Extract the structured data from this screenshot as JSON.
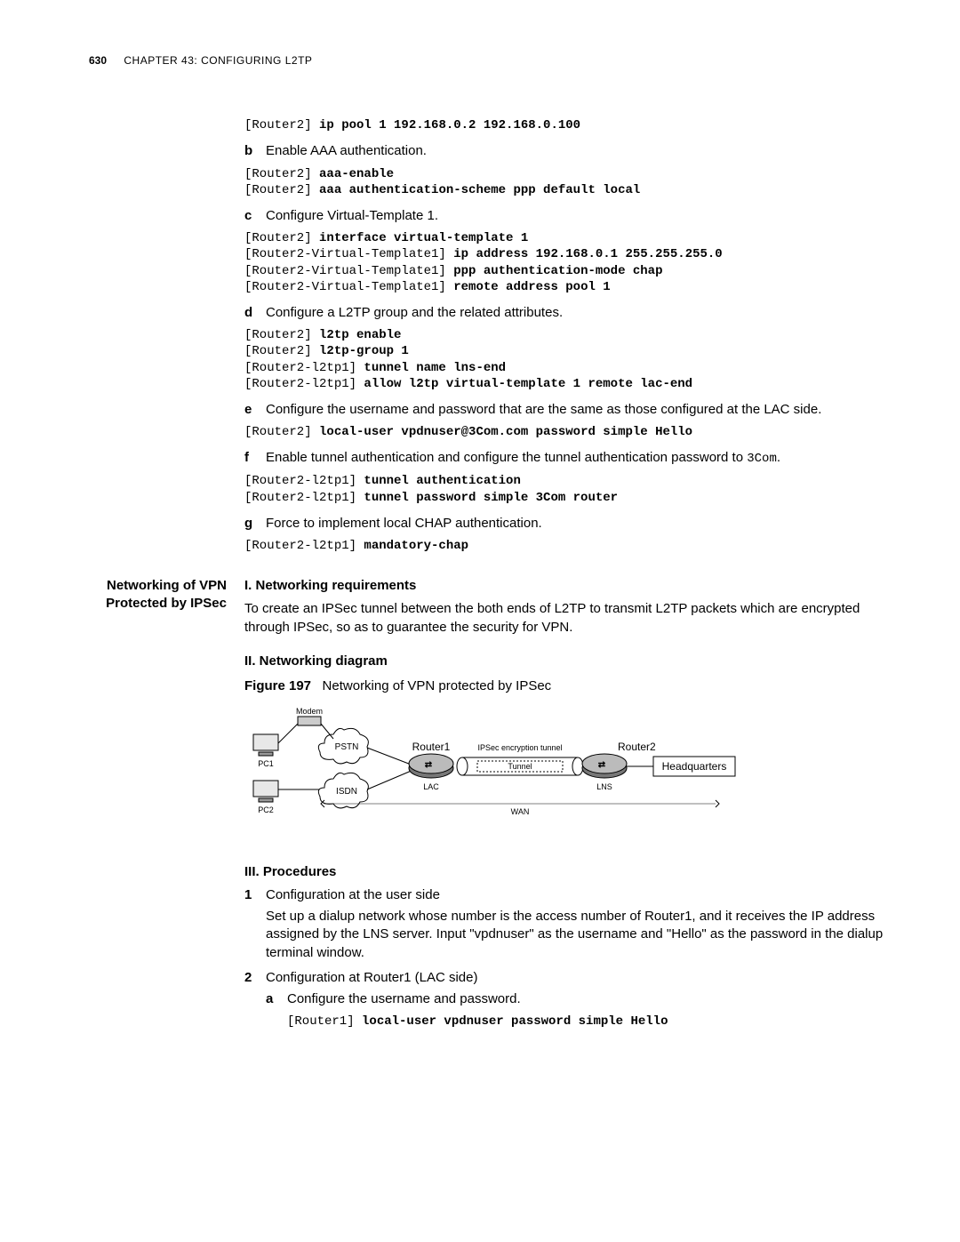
{
  "header": {
    "page": "630",
    "chapter": "CHAPTER 43: CONFIGURING L2TP"
  },
  "block1": {
    "code1_prompt": "[Router2] ",
    "code1_cmd": "ip pool 1 192.168.0.2 192.168.0.100",
    "b_marker": "b",
    "b_text": "Enable AAA authentication.",
    "code2_p1": "[Router2] ",
    "code2_c1": "aaa-enable",
    "code2_p2": "[Router2] ",
    "code2_c2": "aaa authentication-scheme ppp default local",
    "c_marker": "c",
    "c_text": "Configure Virtual-Template 1.",
    "code3_p1": "[Router2] ",
    "code3_c1": "interface virtual-template 1",
    "code3_p2": "[Router2-Virtual-Template1] ",
    "code3_c2": "ip address 192.168.0.1 255.255.255.0",
    "code3_p3": "[Router2-Virtual-Template1] ",
    "code3_c3": "ppp authentication-mode chap",
    "code3_p4": "[Router2-Virtual-Template1] ",
    "code3_c4": "remote address pool 1",
    "d_marker": "d",
    "d_text": "Configure a L2TP group and the related attributes.",
    "code4_p1": "[Router2] ",
    "code4_c1": "l2tp enable",
    "code4_p2": "[Router2] ",
    "code4_c2": "l2tp-group 1",
    "code4_p3": "[Router2-l2tp1] ",
    "code4_c3": "tunnel name lns-end",
    "code4_p4": "[Router2-l2tp1] ",
    "code4_c4": "allow l2tp virtual-template 1 remote lac-end",
    "e_marker": "e",
    "e_text": "Configure the username and password that are the same as those configured at the LAC side.",
    "code5_p1": "[Router2] ",
    "code5_c1": "local-user vpdnuser@3Com.com password simple Hello",
    "f_marker": "f",
    "f_text_a": "Enable tunnel authentication and configure the tunnel authentication password to ",
    "f_text_code": "3Com",
    "f_text_b": ".",
    "code6_p1": "[Router2-l2tp1] ",
    "code6_c1": "tunnel authentication",
    "code6_p2": "[Router2-l2tp1] ",
    "code6_c2": "tunnel password simple 3Com router",
    "g_marker": "g",
    "g_text": "Force to implement local CHAP authentication.",
    "code7_p1": "[Router2-l2tp1] ",
    "code7_c1": "mandatory-chap"
  },
  "section": {
    "side_title_l1": "Networking of VPN",
    "side_title_l2": "Protected by IPSec",
    "h1": "I. Networking requirements",
    "p1": "To create an IPSec tunnel between the both ends of L2TP to transmit L2TP packets which are encrypted through IPSec, so as to guarantee the security for VPN.",
    "h2": "II. Networking diagram",
    "fig_label": "Figure 197",
    "fig_caption": "Networking of VPN protected by IPSec",
    "h3": "III. Procedures",
    "s1_marker": "1",
    "s1_title": "Configuration at the user side",
    "s1_body": "Set up a dialup network whose number is the access number of Router1, and it receives the IP address assigned by the LNS server. Input \"vpdnuser\" as the username and \"Hello\" as the password in the dialup terminal window.",
    "s2_marker": "2",
    "s2_title": "Configuration at Router1 (LAC side)",
    "s2a_marker": "a",
    "s2a_text": "Configure the username and password.",
    "code8_p1": "[Router1] ",
    "code8_c1": "local-user vpdnuser password simple Hello"
  },
  "diagram": {
    "modem": "Modem",
    "pc1": "PC1",
    "pc2": "PC2",
    "pstn": "PSTN",
    "isdn": "ISDN",
    "router1": "Router1",
    "lac": "LAC",
    "tunnel": "Tunnel",
    "ipsec": "IPSec encryption tunnel",
    "router2": "Router2",
    "lns": "LNS",
    "hq": "Headquarters",
    "wan": "WAN"
  }
}
